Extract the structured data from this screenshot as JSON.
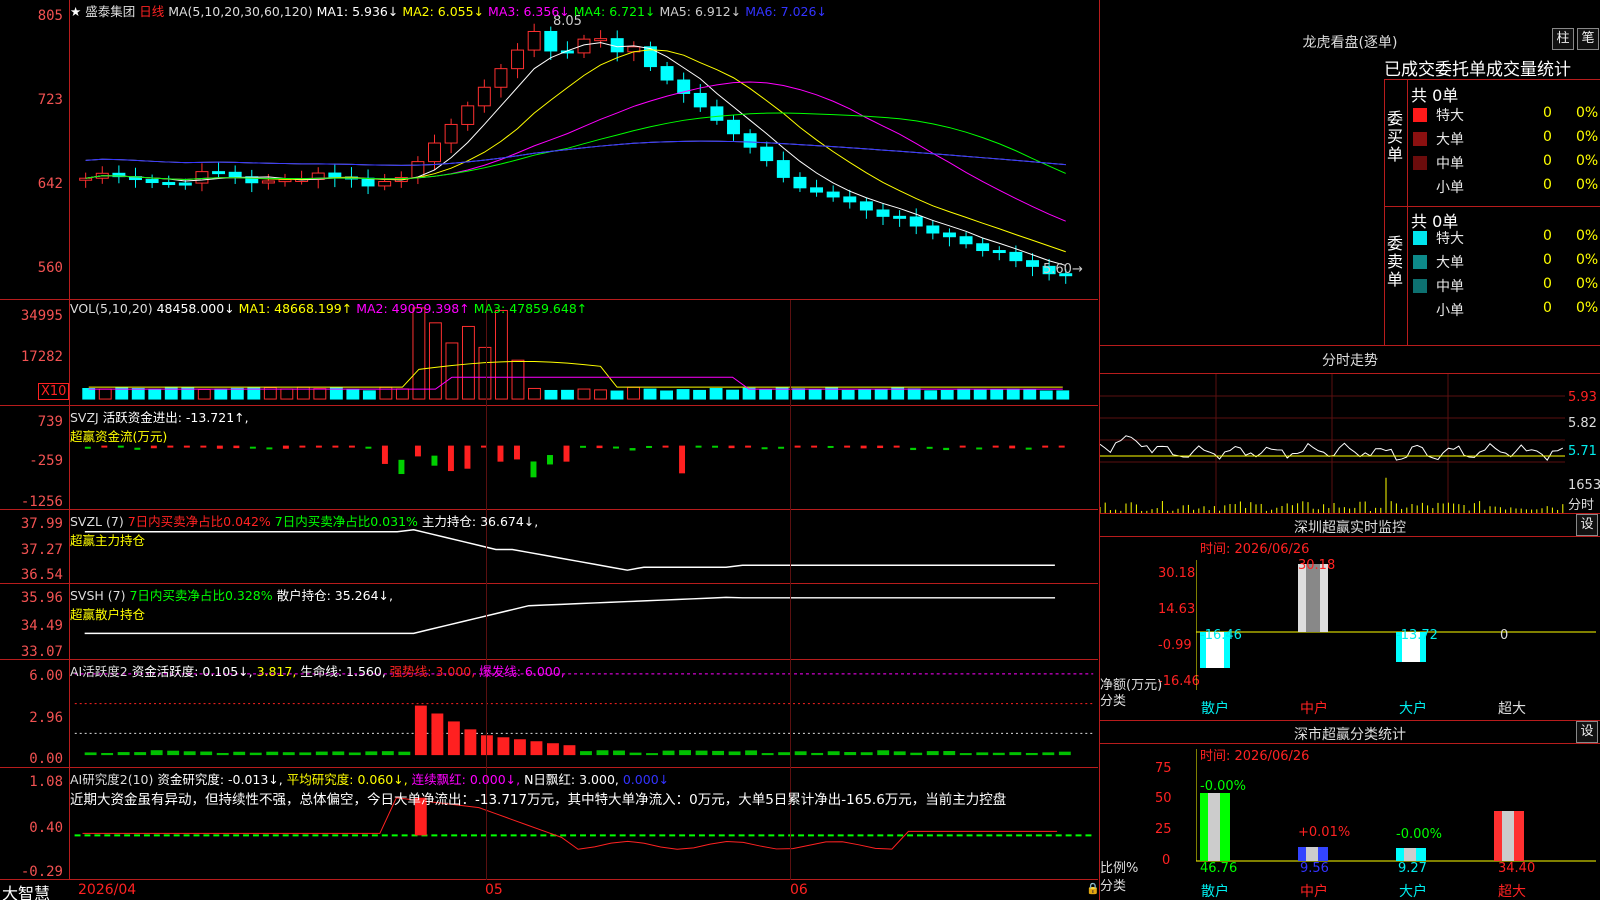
{
  "price_header": {
    "star": "★",
    "name": "盛泰集团",
    "period": "日线",
    "ma_params": "MA(5,10,20,30,60,120)",
    "ma1": "MA1: 5.936↓",
    "ma2": "MA2: 6.055↓",
    "ma3": "MA3: 6.356↓",
    "ma4": "MA4: 6.721↓",
    "ma5": "MA5: 6.912↓",
    "ma6": "MA6: 7.026↓"
  },
  "price_axis": [
    "805",
    "723",
    "642",
    "560"
  ],
  "price_marks": {
    "high": "8.05",
    "last": "5.60→"
  },
  "vol_header": {
    "name": "VOL(5,10,20)",
    "v": "48458.000↓",
    "ma1": "MA1: 48668.199↑",
    "ma2": "MA2: 49059.398↑",
    "ma3": "MA3: 47859.648↑"
  },
  "vol_axis": [
    "34995",
    "17282"
  ],
  "vol_unit": "X10",
  "svzj_header": {
    "name": "SVZJ",
    "label": "活跃资金进出: -13.721↑,",
    "sub": "超赢资金流(万元)"
  },
  "svzj_axis": [
    "739",
    "-259",
    "-1256"
  ],
  "svzl_header": {
    "name": "SVZL (7)",
    "a": "7日内买卖净占比0.042%",
    "b": "7日内买卖净占比0.031%",
    "c": "主力持仓: 36.674↓,",
    "sub": "超赢主力持仓"
  },
  "svzl_axis": [
    "37.99",
    "37.27",
    "36.54"
  ],
  "svsh_header": {
    "name": "SVSH (7)",
    "a": "7日内买卖净占比0.328%",
    "c": "散户持仓: 35.264↓,",
    "sub": "超赢散户持仓"
  },
  "svsh_axis": [
    "35.96",
    "34.49",
    "33.07"
  ],
  "ai1_header": {
    "name": "AI活跃度2",
    "a": "资金活跃度: 0.105↓,",
    "b": "3.817,",
    "c": "生命线: 1.560,",
    "d": "强势线: 3.000,",
    "e": "爆发线: 6.000,"
  },
  "ai1_axis": [
    "6.00",
    "2.96",
    "0.00"
  ],
  "ai2_header": {
    "name": "AI研究度2(10)",
    "a": "资金研究度: -0.013↓,",
    "b": "平均研究度: 0.060↓,",
    "c": "连续飘红: 0.000↓,",
    "d": "N日飘红: 3.000,",
    "e": "0.000↓"
  },
  "ai2_comment": "近期大资金虽有异动，但持续性不强，总体偏空，今日大单净流出：-13.717万元，其中特大单净流入：0万元，大单5日累计净出-165.6万元，当前主力控盘",
  "ai2_axis": [
    "1.08",
    "0.40",
    "-0.29"
  ],
  "bottom": {
    "brand": "大智慧",
    "date": "2026/04",
    "m05": "05",
    "m06": "06"
  },
  "lhb": {
    "title": "龙虎看盘(逐单)",
    "btn1": "柱",
    "btn2": "笔",
    "stat_title": "已成交委托单成交量统计",
    "buy_label": "委买单",
    "sell_label": "委卖单",
    "buy_total": "共 0单",
    "sell_total": "共 0单",
    "buy_rows": [
      {
        "cat": "特大",
        "n": "0",
        "p": "0%",
        "color": "#ff1a1a"
      },
      {
        "cat": "大单",
        "n": "0",
        "p": "0%",
        "color": "#8b1010"
      },
      {
        "cat": "中单",
        "n": "0",
        "p": "0%",
        "color": "#6b0c0c"
      },
      {
        "cat": "小单",
        "n": "0",
        "p": "0%",
        "color": ""
      }
    ],
    "sell_rows": [
      {
        "cat": "特大",
        "n": "0",
        "p": "0%",
        "color": "#00e5ee"
      },
      {
        "cat": "大单",
        "n": "0",
        "p": "0%",
        "color": "#0d8a8a"
      },
      {
        "cat": "中单",
        "n": "0",
        "p": "0%",
        "color": "#0d7070"
      },
      {
        "cat": "小单",
        "n": "0",
        "p": "0%",
        "color": ""
      }
    ]
  },
  "fenshi": {
    "title": "分时走势",
    "p1": "5.93",
    "p2": "5.82",
    "p3": "5.71",
    "vol": "1653",
    "unit": "分时"
  },
  "szmon": {
    "title": "深圳超赢实时监控",
    "btn": "设",
    "time": "时间: 2026/06/26",
    "axis": [
      "30.18",
      "14.63",
      "-0.99",
      "-16.46"
    ],
    "bars": [
      {
        "v": "-16.46"
      },
      {
        "v": "30.18"
      },
      {
        "v": "-13.72"
      },
      {
        "v": "0"
      }
    ],
    "ylabel": "净额(万元)",
    "xlabel": "分类",
    "cats": [
      "散户",
      "中户",
      "大户",
      "超大"
    ]
  },
  "szcls": {
    "title": "深市超赢分类统计",
    "btn": "设",
    "time": "时间: 2026/06/26",
    "axis": [
      "75",
      "50",
      "25",
      "0"
    ],
    "top": [
      "-0.00%",
      "+0.01%",
      "-0.00%",
      ""
    ],
    "bot": [
      "46.76",
      "9.56",
      "9.27",
      "34.40"
    ],
    "ylabel": "比例%",
    "xlabel": "分类",
    "cats": [
      "散户",
      "中户",
      "大户",
      "超大"
    ]
  },
  "chart_data": {
    "type": "candlestick",
    "title": "盛泰集团 日线",
    "ylim": [
      5.6,
      8.05
    ],
    "x_marks": [
      "2026/04",
      "05",
      "06"
    ],
    "high": 8.05,
    "last": 5.6
  }
}
